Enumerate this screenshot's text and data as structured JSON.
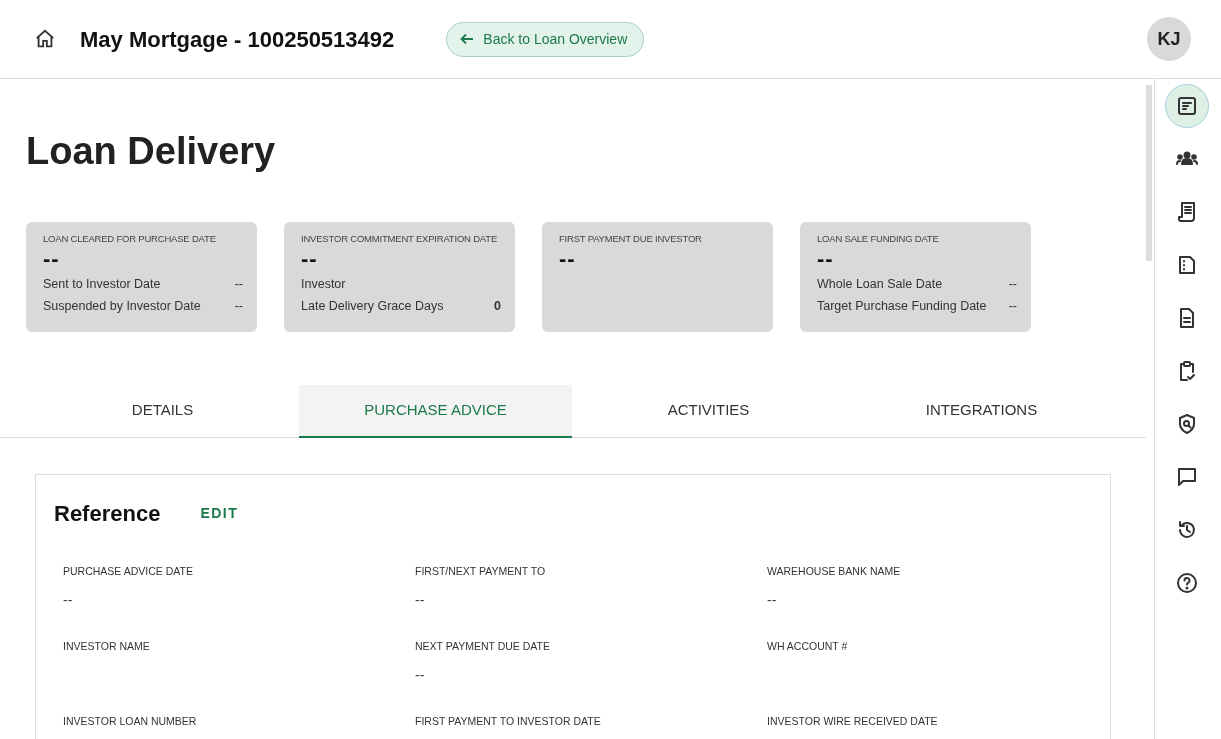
{
  "header": {
    "title": "May Mortgage - 100250513492",
    "back_button": "Back to Loan Overview",
    "avatar": "KJ"
  },
  "page_title": "Loan Delivery",
  "summary_cards": [
    {
      "title": "LOAN CLEARED FOR PURCHASE DATE",
      "value": "--",
      "rows": [
        {
          "label": "Sent to Investor Date",
          "value": "--"
        },
        {
          "label": "Suspended by Investor Date",
          "value": "--"
        }
      ]
    },
    {
      "title": "INVESTOR COMMITMENT EXPIRATION DATE",
      "value": "--",
      "rows": [
        {
          "label": "Investor"
        },
        {
          "label": "Late Delivery Grace Days",
          "value": "0"
        }
      ]
    },
    {
      "title": "FIRST PAYMENT DUE INVESTOR",
      "value": "--"
    },
    {
      "title": "LOAN SALE FUNDING DATE",
      "value": "--",
      "rows": [
        {
          "label": "Whole Loan Sale Date",
          "value": "--"
        },
        {
          "label": "Target Purchase Funding Date",
          "value": "--"
        }
      ]
    }
  ],
  "tabs": [
    {
      "label": "DETAILS",
      "selected": false
    },
    {
      "label": "PURCHASE ADVICE",
      "selected": true
    },
    {
      "label": "ACTIVITIES",
      "selected": false
    },
    {
      "label": "INTEGRATIONS",
      "selected": false
    }
  ],
  "section": {
    "title": "Reference",
    "edit": "EDIT",
    "fields": [
      {
        "label": "PURCHASE ADVICE DATE",
        "value": "--"
      },
      {
        "label": "FIRST/NEXT PAYMENT TO",
        "value": "--"
      },
      {
        "label": "WAREHOUSE BANK NAME",
        "value": "--"
      },
      {
        "label": "INVESTOR NAME"
      },
      {
        "label": "NEXT PAYMENT DUE DATE",
        "value": "--"
      },
      {
        "label": "WH ACCOUNT #"
      },
      {
        "label": "INVESTOR LOAN NUMBER"
      },
      {
        "label": "FIRST PAYMENT TO INVESTOR DATE"
      },
      {
        "label": "INVESTOR WIRE RECEIVED DATE"
      }
    ]
  },
  "rail": [
    {
      "kind": "summary",
      "selected": true
    },
    {
      "kind": "people",
      "selected": false
    },
    {
      "kind": "receipt",
      "selected": false
    },
    {
      "kind": "page",
      "selected": false
    },
    {
      "kind": "document",
      "selected": false
    },
    {
      "kind": "clipboard",
      "selected": false
    },
    {
      "kind": "shield",
      "selected": false
    },
    {
      "kind": "chat",
      "selected": false
    },
    {
      "kind": "history",
      "selected": false
    },
    {
      "kind": "help",
      "selected": false
    }
  ]
}
